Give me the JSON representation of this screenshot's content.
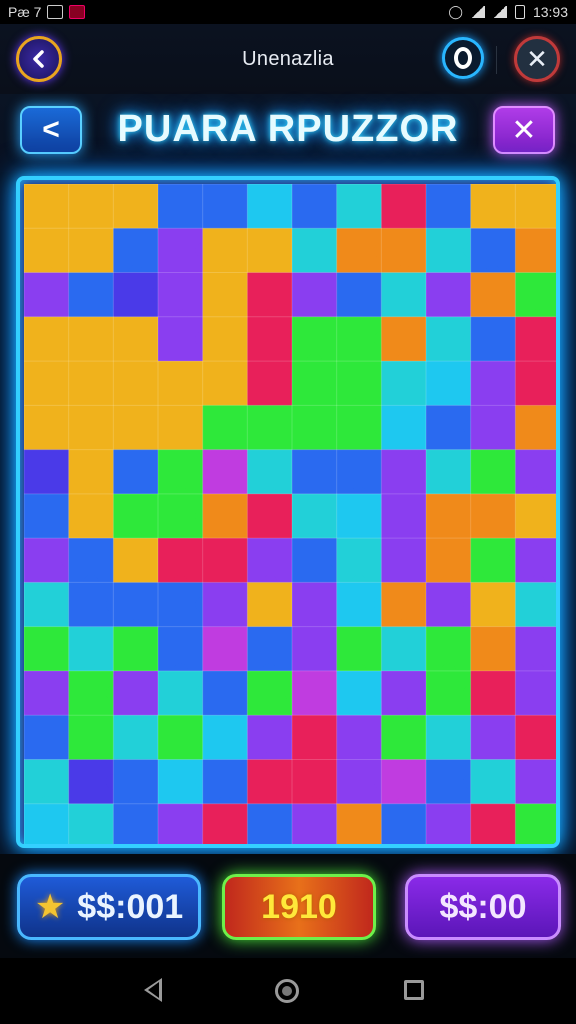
{
  "status_bar": {
    "left_text": "Pæ 7",
    "time": "13:93"
  },
  "app_bar": {
    "title": "Unenazlia",
    "back_icon": "chevron-left-icon",
    "ring_icon": "ring-icon",
    "close_glyph": "✕"
  },
  "game_header": {
    "title": "PUARA RPUZZOR",
    "back_glyph": "<",
    "close_glyph": "✕"
  },
  "board": {
    "columns": 12,
    "rows": 15,
    "palette": {
      "Y": "#f0b21c",
      "O": "#f08a1a",
      "G": "#2ee83a",
      "T": "#22d0d8",
      "C": "#1ec8f0",
      "B": "#2a6af0",
      "I": "#4a3ae8",
      "P": "#8a3ef0",
      "M": "#c03ce0",
      "R": "#e8205a",
      "K": "#f04aa0"
    },
    "cells": [
      "YYYBBCBTRBYY",
      "YYBPYYTOOTBO",
      "PBIPYRPBTPOG",
      "YYYPYRGGOTBR",
      "YYYYYRGGTCPR",
      "YYYYGGGGCBPO",
      "IYBGMTBBPTGP",
      "BYGGORTCPOOY",
      "PBYRRPBTPOGP",
      "TBBBPYPCOPYT",
      "GTGBMBPGTGOP",
      "PGPTBGMCPGRP",
      "BGTGCPRPGTPR",
      "TIBCBRRPMBTP",
      "CTBPRBPOBPRG"
    ]
  },
  "bottom_bar": {
    "left_value": "$$:001",
    "middle_value": "1910",
    "right_value": "$$:00"
  },
  "nav_bar": {
    "back_icon": "back-triangle-icon",
    "home_icon": "home-circle-icon",
    "recent_icon": "recent-square-icon"
  }
}
